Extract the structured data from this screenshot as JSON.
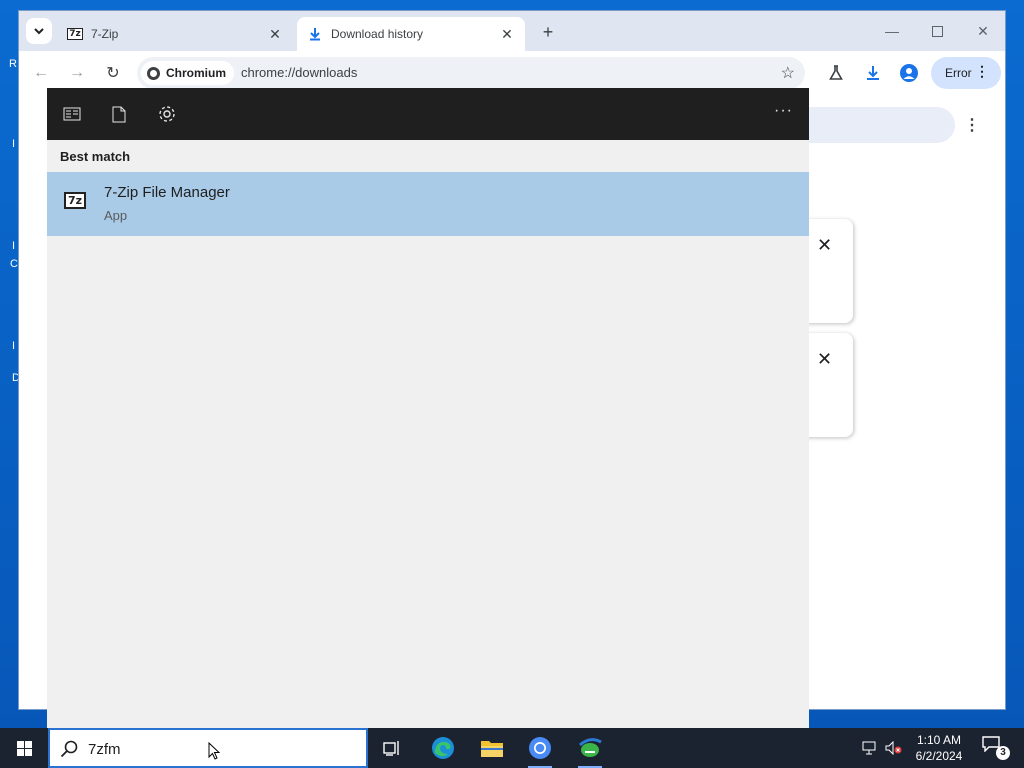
{
  "browser": {
    "tabs": [
      {
        "title": "7-Zip",
        "icon": "7z-icon",
        "active": false
      },
      {
        "title": "Download history",
        "icon": "download-icon",
        "active": true
      }
    ],
    "chip_label": "Chromium",
    "url": "chrome://downloads",
    "profile_status": "Error"
  },
  "search_panel": {
    "section_label": "Best match",
    "best_match": {
      "icon_text": "7z",
      "title": "7-Zip File Manager",
      "subtitle": "App"
    }
  },
  "taskbar": {
    "search_value": "7zfm",
    "clock_time": "1:10 AM",
    "clock_date": "6/2/2024",
    "notification_count": "3"
  }
}
